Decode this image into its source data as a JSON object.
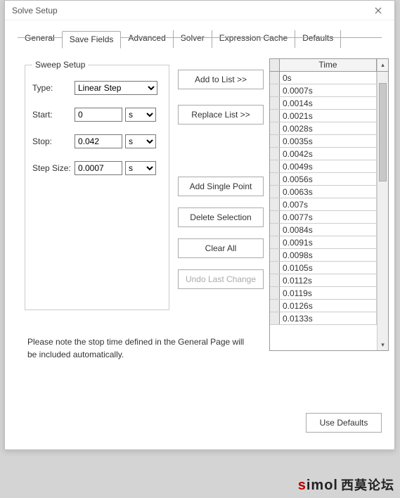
{
  "window": {
    "title": "Solve Setup"
  },
  "tabs": {
    "items": [
      {
        "label": "General"
      },
      {
        "label": "Save Fields"
      },
      {
        "label": "Advanced"
      },
      {
        "label": "Solver"
      },
      {
        "label": "Expression Cache"
      },
      {
        "label": "Defaults"
      }
    ],
    "active_index": 1
  },
  "sweep": {
    "legend": "Sweep Setup",
    "type_label": "Type:",
    "type_value": "Linear Step",
    "start_label": "Start:",
    "start_value": "0",
    "start_unit": "s",
    "stop_label": "Stop:",
    "stop_value": "0.042",
    "stop_unit": "s",
    "step_label": "Step Size:",
    "step_value": "0.0007",
    "step_unit": "s"
  },
  "buttons": {
    "add_to_list": "Add to List >>",
    "replace_list": "Replace List >>",
    "add_single_point": "Add Single Point",
    "delete_selection": "Delete Selection",
    "clear_all": "Clear All",
    "undo_last_change": "Undo Last Change",
    "use_defaults": "Use Defaults"
  },
  "table": {
    "header": "Time",
    "rows": [
      "0s",
      "0.0007s",
      "0.0014s",
      "0.0021s",
      "0.0028s",
      "0.0035s",
      "0.0042s",
      "0.0049s",
      "0.0056s",
      "0.0063s",
      "0.007s",
      "0.0077s",
      "0.0084s",
      "0.0091s",
      "0.0098s",
      "0.0105s",
      "0.0112s",
      "0.0119s",
      "0.0126s",
      "0.0133s"
    ]
  },
  "note": "Please note the stop time defined in the General Page will be included automatically.",
  "watermark": {
    "brand": "simol",
    "cn": "西莫论坛"
  }
}
